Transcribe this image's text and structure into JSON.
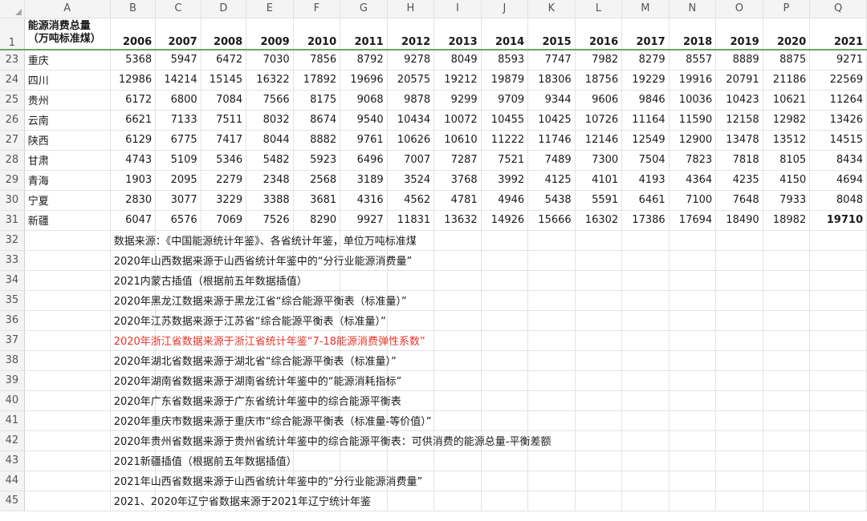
{
  "columns": [
    "A",
    "B",
    "C",
    "D",
    "E",
    "F",
    "G",
    "H",
    "I",
    "J",
    "K",
    "L",
    "M",
    "N",
    "O",
    "P",
    "Q"
  ],
  "header": {
    "row_number": "1",
    "title_line1": "能源消费总量",
    "title_line2": "（万吨标准煤）",
    "years": [
      "2006",
      "2007",
      "2008",
      "2009",
      "2010",
      "2011",
      "2012",
      "2013",
      "2014",
      "2015",
      "2016",
      "2017",
      "2018",
      "2019",
      "2020",
      "2021"
    ]
  },
  "rows": [
    {
      "row": "23",
      "province": "重庆",
      "values": [
        "5368",
        "5947",
        "6472",
        "7030",
        "7856",
        "8792",
        "9278",
        "8049",
        "8593",
        "7747",
        "7982",
        "8279",
        "8557",
        "8889",
        "8875",
        "9271"
      ]
    },
    {
      "row": "24",
      "province": "四川",
      "values": [
        "12986",
        "14214",
        "15145",
        "16322",
        "17892",
        "19696",
        "20575",
        "19212",
        "19879",
        "18306",
        "18756",
        "19229",
        "19916",
        "20791",
        "21186",
        "22569"
      ]
    },
    {
      "row": "25",
      "province": "贵州",
      "values": [
        "6172",
        "6800",
        "7084",
        "7566",
        "8175",
        "9068",
        "9878",
        "9299",
        "9709",
        "9344",
        "9606",
        "9846",
        "10036",
        "10423",
        "10621",
        "11264"
      ]
    },
    {
      "row": "26",
      "province": "云南",
      "values": [
        "6621",
        "7133",
        "7511",
        "8032",
        "8674",
        "9540",
        "10434",
        "10072",
        "10455",
        "10425",
        "10726",
        "11164",
        "11590",
        "12158",
        "12982",
        "13426"
      ]
    },
    {
      "row": "27",
      "province": "陕西",
      "values": [
        "6129",
        "6775",
        "7417",
        "8044",
        "8882",
        "9761",
        "10626",
        "10610",
        "11222",
        "11746",
        "12146",
        "12549",
        "12900",
        "13478",
        "13512",
        "14515"
      ]
    },
    {
      "row": "28",
      "province": "甘肃",
      "values": [
        "4743",
        "5109",
        "5346",
        "5482",
        "5923",
        "6496",
        "7007",
        "7287",
        "7521",
        "7489",
        "7300",
        "7504",
        "7823",
        "7818",
        "8105",
        "8434"
      ]
    },
    {
      "row": "29",
      "province": "青海",
      "values": [
        "1903",
        "2095",
        "2279",
        "2348",
        "2568",
        "3189",
        "3524",
        "3768",
        "3992",
        "4125",
        "4101",
        "4193",
        "4364",
        "4235",
        "4150",
        "4694"
      ]
    },
    {
      "row": "30",
      "province": "宁夏",
      "values": [
        "2830",
        "3077",
        "3229",
        "3388",
        "3681",
        "4316",
        "4562",
        "4781",
        "4946",
        "5438",
        "5591",
        "6461",
        "7100",
        "7648",
        "7933",
        "8048"
      ]
    },
    {
      "row": "31",
      "province": "新疆",
      "values": [
        "6047",
        "6576",
        "7069",
        "7526",
        "8290",
        "9927",
        "11831",
        "13632",
        "14926",
        "15666",
        "16302",
        "17386",
        "17694",
        "18490",
        "18982",
        "19710"
      ]
    }
  ],
  "notes": [
    {
      "row": "32",
      "text": "数据来源：《中国能源统计年鉴》、各省统计年鉴，单位万吨标准煤"
    },
    {
      "row": "33",
      "text": "2020年山西数据来源于山西省统计年鉴中的“分行业能源消费量”"
    },
    {
      "row": "34",
      "text": "2021内蒙古插值（根据前五年数据插值）"
    },
    {
      "row": "35",
      "text": "2020年黑龙江数据来源于黑龙江省“综合能源平衡表（标准量）”"
    },
    {
      "row": "36",
      "text": "2020年江苏数据来源于江苏省“综合能源平衡表（标准量）”"
    },
    {
      "row": "37",
      "text": "2020年浙江省数据来源于浙江省统计年鉴“7-18能源消费弹性系数”"
    },
    {
      "row": "38",
      "text": "2020年湖北省数据来源于湖北省“综合能源平衡表（标准量）”"
    },
    {
      "row": "39",
      "text": "2020年湖南省数据来源于湖南省统计年鉴中的“能源消耗指标”"
    },
    {
      "row": "40",
      "text": "2020年广东省数据来源于广东省统计年鉴中的综合能源平衡表"
    },
    {
      "row": "41",
      "text": "2020年重庆市数据来源于重庆市“综合能源平衡表（标准量-等价值）”"
    },
    {
      "row": "42",
      "text": "2020年贵州省数据来源于贵州省统计年鉴中的综合能源平衡表：可供消费的能源总量-平衡差额"
    },
    {
      "row": "43",
      "text": "2021新疆插值（根据前五年数据插值）"
    },
    {
      "row": "44",
      "text": "2021年山西省数据来源于山西省统计年鉴中的“分行业能源消费量”"
    },
    {
      "row": "45",
      "text": "2021、2020年辽宁省数据来源于2021年辽宁统计年鉴"
    }
  ],
  "colors": {
    "note_highlight": "#e8342b",
    "header_bg": "#f4f4f4",
    "freeze_line": "#6aa56a"
  }
}
